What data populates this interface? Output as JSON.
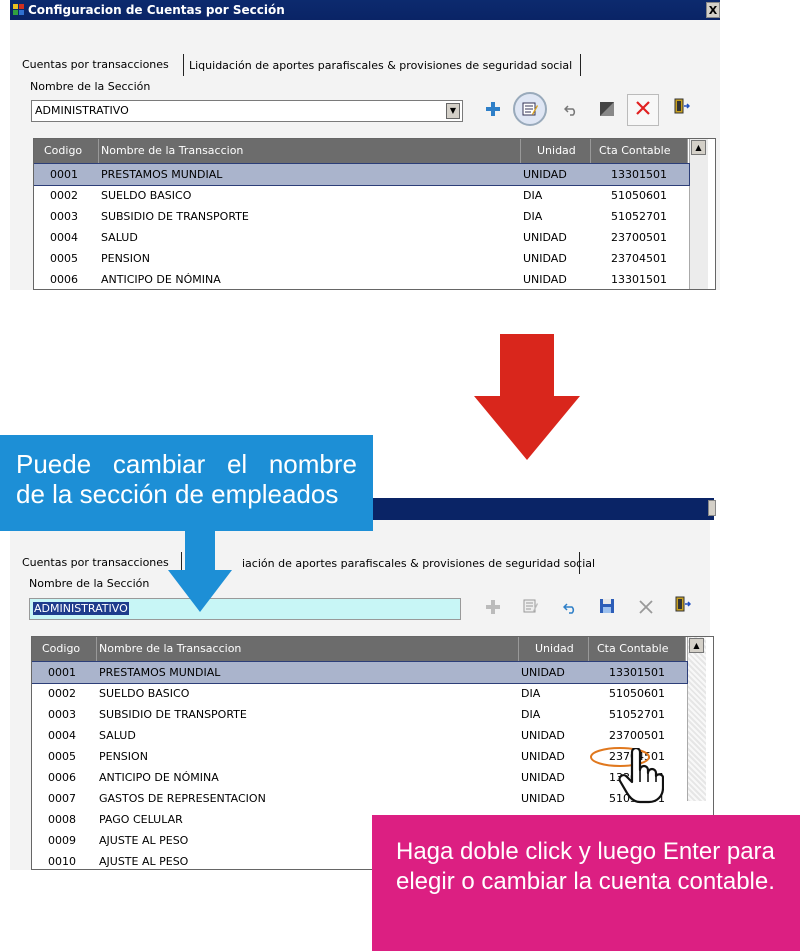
{
  "window": {
    "title": "Configuracion de Cuentas por Sección",
    "close_glyph": "X"
  },
  "tabs": [
    {
      "label": "Cuentas por transacciones"
    },
    {
      "label": "Liquidación de aportes parafiscales & provisiones de seguridad social"
    }
  ],
  "tab2_partial": "iación de aportes parafiscales & provisiones de seguridad social",
  "section_label": "Nombre de la Sección",
  "section_value": "ADMINISTRATIVO",
  "combo_arrow": "▼",
  "toolbar_icons": [
    "plus-icon",
    "edit-icon",
    "undo-icon",
    "save-icon",
    "delete-icon",
    "exit-icon"
  ],
  "columns": [
    "Codigo",
    "Nombre de la Transaccion",
    "Unidad",
    "Cta Contable"
  ],
  "rows": [
    {
      "codigo": "0001",
      "nombre": "PRESTAMOS MUNDIAL",
      "unidad": "UNIDAD",
      "cta": "13301501"
    },
    {
      "codigo": "0002",
      "nombre": "SUELDO BASICO",
      "unidad": "DIA",
      "cta": "51050601"
    },
    {
      "codigo": "0003",
      "nombre": "SUBSIDIO DE TRANSPORTE",
      "unidad": "DIA",
      "cta": "51052701"
    },
    {
      "codigo": "0004",
      "nombre": "SALUD",
      "unidad": "UNIDAD",
      "cta": "23700501"
    },
    {
      "codigo": "0005",
      "nombre": "PENSION",
      "unidad": "UNIDAD",
      "cta": "23704501"
    },
    {
      "codigo": "0006",
      "nombre": "ANTICIPO DE NÓMINA",
      "unidad": "UNIDAD",
      "cta": "13301501"
    },
    {
      "codigo": "0007",
      "nombre": "GASTOS DE REPRESENTACION",
      "unidad": "UNIDAD",
      "cta": "51052101"
    },
    {
      "codigo": "0008",
      "nombre": "PAGO CELULAR",
      "unidad": "",
      "cta": ""
    },
    {
      "codigo": "0009",
      "nombre": "AJUSTE AL PESO",
      "unidad": "",
      "cta": ""
    },
    {
      "codigo": "0010",
      "nombre": "AJUSTE AL PESO",
      "unidad": "",
      "cta": ""
    }
  ],
  "callouts": {
    "blue_line1": "Puede cambiar el nombre",
    "blue_line2": "de la sección de empleados",
    "pink": "Haga doble click y luego Enter para elegir o cambiar la cuenta contable."
  },
  "colors": {
    "arrow_red": "#d9261c",
    "callout_blue": "#1d8fd6",
    "callout_pink": "#dc1f82",
    "titlebar": "#0a2466",
    "highlight_edit": "#c8f6f6"
  }
}
